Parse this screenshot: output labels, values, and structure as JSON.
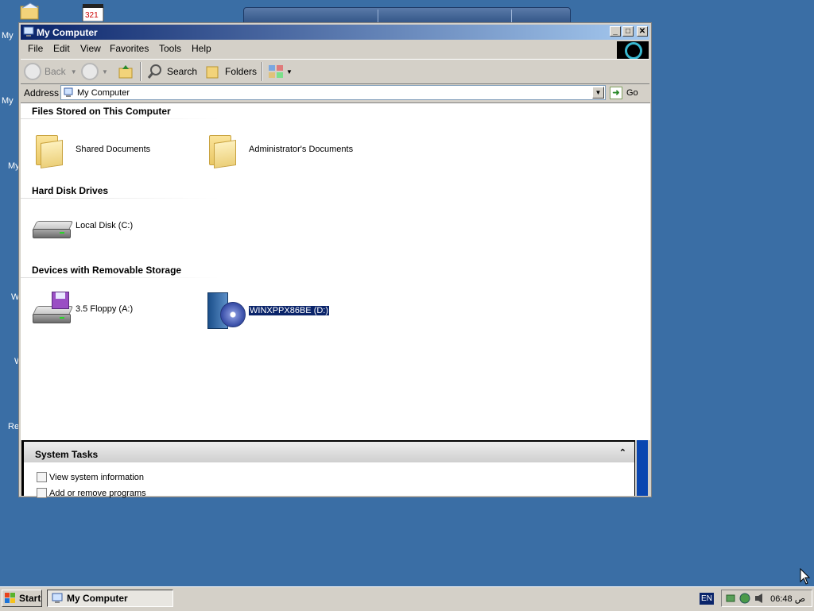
{
  "desktop": {
    "labels": [
      "My",
      "My",
      "My",
      "W",
      "W",
      "Re"
    ]
  },
  "window": {
    "title": "My Computer",
    "buttons": {
      "minimize": "_",
      "maximize": "□",
      "close": "✕"
    },
    "menu": [
      "File",
      "Edit",
      "View",
      "Favorites",
      "Tools",
      "Help"
    ],
    "toolbar": {
      "back": "Back",
      "search": "Search",
      "folders": "Folders"
    },
    "address": {
      "label": "Address",
      "value": "My Computer",
      "go": "Go"
    },
    "groups": [
      {
        "title": "Files Stored on This Computer",
        "items": [
          "Shared Documents",
          "Administrator's Documents"
        ]
      },
      {
        "title": "Hard Disk Drives",
        "items": [
          "Local Disk (C:)"
        ]
      },
      {
        "title": "Devices with Removable Storage",
        "items": [
          "3.5 Floppy (A:)",
          "WINXPPX86BE (D:)"
        ]
      }
    ],
    "tasks": {
      "title": "System Tasks",
      "links": [
        "View system information",
        "Add or remove programs"
      ]
    }
  },
  "taskbar": {
    "start": "Start",
    "task_button": "My Computer",
    "language": "EN",
    "clock": "06:48 ص"
  }
}
